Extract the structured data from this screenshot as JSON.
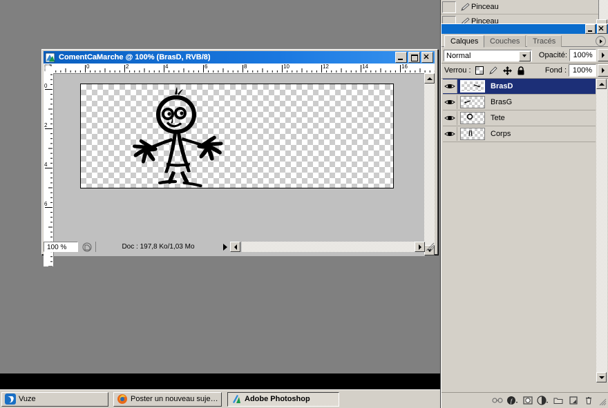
{
  "desktop": {
    "background_color": "#808080"
  },
  "document_window": {
    "title": "ComentCaMarche @ 100% (BrasD, RVB/8)",
    "title_icon": "photoshop-document-icon",
    "titlebar_color": "#0a5fc0",
    "buttons": {
      "minimize": "minimize-button",
      "maximize": "maximize-button",
      "close": "close-button"
    },
    "rulers": {
      "horizontal_labels": [
        "0",
        "2",
        "4",
        "6",
        "8",
        "10",
        "12",
        "14",
        "16"
      ],
      "vertical_labels": [
        "0",
        "2",
        "4",
        "6"
      ],
      "unit": "cm"
    },
    "statusbar": {
      "zoom": "100 %",
      "proxy_icon": "document-proxy-icon",
      "doc_info": "Doc : 197,8 Ko/1,03 Mo",
      "play_icon": "status-arrow-icon"
    }
  },
  "history_panel": {
    "items": [
      {
        "label": "Pinceau",
        "icon": "brush-icon"
      },
      {
        "label": "Pinceau",
        "icon": "brush-icon"
      }
    ]
  },
  "layers_palette": {
    "titlebar": {
      "minimize": "minimize-button",
      "close": "close-button"
    },
    "tabs": [
      {
        "label": "Calques",
        "active": true
      },
      {
        "label": "Couches",
        "active": false
      },
      {
        "label": "Tracés",
        "active": false
      }
    ],
    "menu_icon": "palette-menu-icon",
    "blend_mode": {
      "value": "Normal",
      "dropdown_icon": "chevron-down-icon"
    },
    "opacity": {
      "label": "Opacité:",
      "value": "100%",
      "spinner_icon": "spinner-arrow-icon"
    },
    "lock": {
      "label": "Verrou :",
      "icons": [
        "lock-transparency-icon",
        "lock-image-icon",
        "lock-position-icon",
        "lock-all-icon"
      ]
    },
    "fill": {
      "label": "Fond :",
      "value": "100%",
      "spinner_icon": "spinner-arrow-icon"
    },
    "layers": [
      {
        "name": "BrasD",
        "visible": true,
        "selected": true,
        "eye_icon": "eye-icon"
      },
      {
        "name": "BrasG",
        "visible": true,
        "selected": false,
        "eye_icon": "eye-icon"
      },
      {
        "name": "Tete",
        "visible": true,
        "selected": false,
        "eye_icon": "eye-icon"
      },
      {
        "name": "Corps",
        "visible": true,
        "selected": false,
        "eye_icon": "eye-icon"
      }
    ],
    "bottom_buttons": [
      {
        "icon": "link-layers-icon"
      },
      {
        "icon": "layer-style-fx-icon"
      },
      {
        "icon": "layer-mask-icon"
      },
      {
        "icon": "adjustment-layer-icon"
      },
      {
        "icon": "new-group-folder-icon"
      },
      {
        "icon": "new-layer-icon"
      },
      {
        "icon": "delete-layer-trash-icon"
      }
    ],
    "selected_row_color": "#1c2f77",
    "panel_background": "#d4d0c8"
  },
  "taskbar": {
    "buttons": [
      {
        "label": "Vuze",
        "icon": "vuze-icon",
        "active": false
      },
      {
        "label": "Poster un nouveau sujet...",
        "icon": "firefox-icon",
        "active": false
      },
      {
        "label": "Adobe Photoshop",
        "icon": "photoshop-icon",
        "active": true
      }
    ]
  }
}
